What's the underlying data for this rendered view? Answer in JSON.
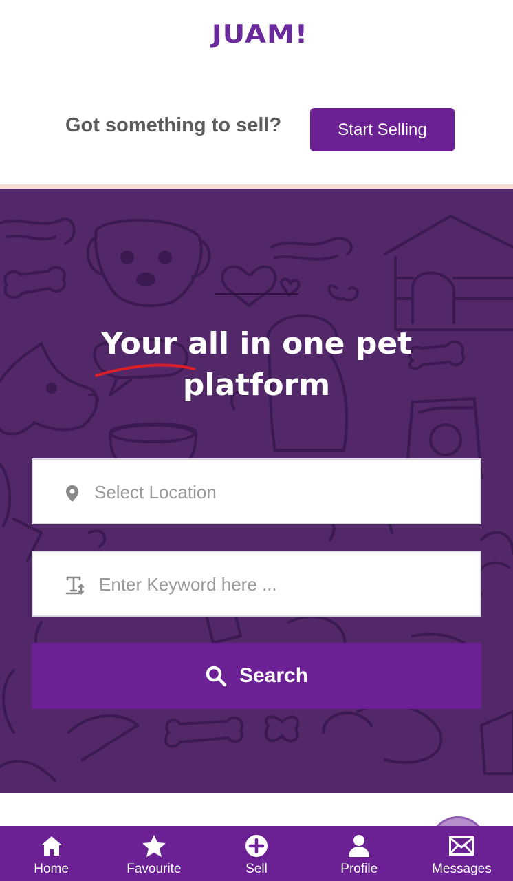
{
  "header": {
    "logo_text": "JUAM!",
    "sell_prompt": "Got something to sell?",
    "start_selling_label": "Start Selling"
  },
  "hero": {
    "title_line1": "Your all in one pet",
    "title_line2": "platform",
    "location_placeholder": "Select Location",
    "keyword_placeholder": "Enter Keyword here ...",
    "search_label": "Search"
  },
  "tabs": [
    {
      "label": "Home",
      "icon": "home-icon"
    },
    {
      "label": "Favourite",
      "icon": "star-icon"
    },
    {
      "label": "Sell",
      "icon": "plus-circle-icon"
    },
    {
      "label": "Profile",
      "icon": "user-icon"
    },
    {
      "label": "Messages",
      "icon": "envelope-icon"
    }
  ],
  "colors": {
    "brand_purple": "#6b2093",
    "hero_background": "#522868",
    "doodle_line": "#3a1a50",
    "accent_red": "#d9202a"
  }
}
